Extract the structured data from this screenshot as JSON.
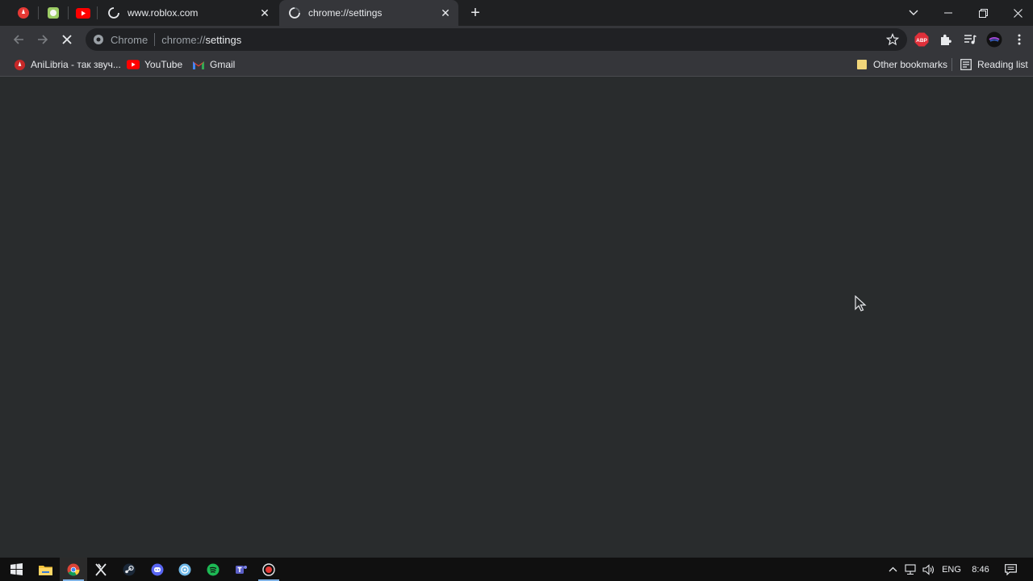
{
  "tabs": [
    {
      "title": "www.roblox.com",
      "close": "✕"
    },
    {
      "title": "chrome://settings",
      "close": "✕"
    }
  ],
  "newtab_label": "+",
  "omnibox": {
    "chip": "Chrome",
    "scheme": "chrome://",
    "host": "settings"
  },
  "extensions": {
    "abp_label": "ABP"
  },
  "bookmarks": {
    "items": [
      {
        "label": "AniLibria - так звуч..."
      },
      {
        "label": "YouTube"
      },
      {
        "label": "Gmail"
      }
    ],
    "other": "Other bookmarks",
    "reading_list": "Reading list"
  },
  "taskbar": {
    "language": "ENG",
    "time": "8:46"
  },
  "colors": {
    "content_bg": "#292c2d",
    "toolbar_bg": "#35363a",
    "tabstrip_bg": "#1f2022",
    "taskbar_bg": "#101010"
  }
}
